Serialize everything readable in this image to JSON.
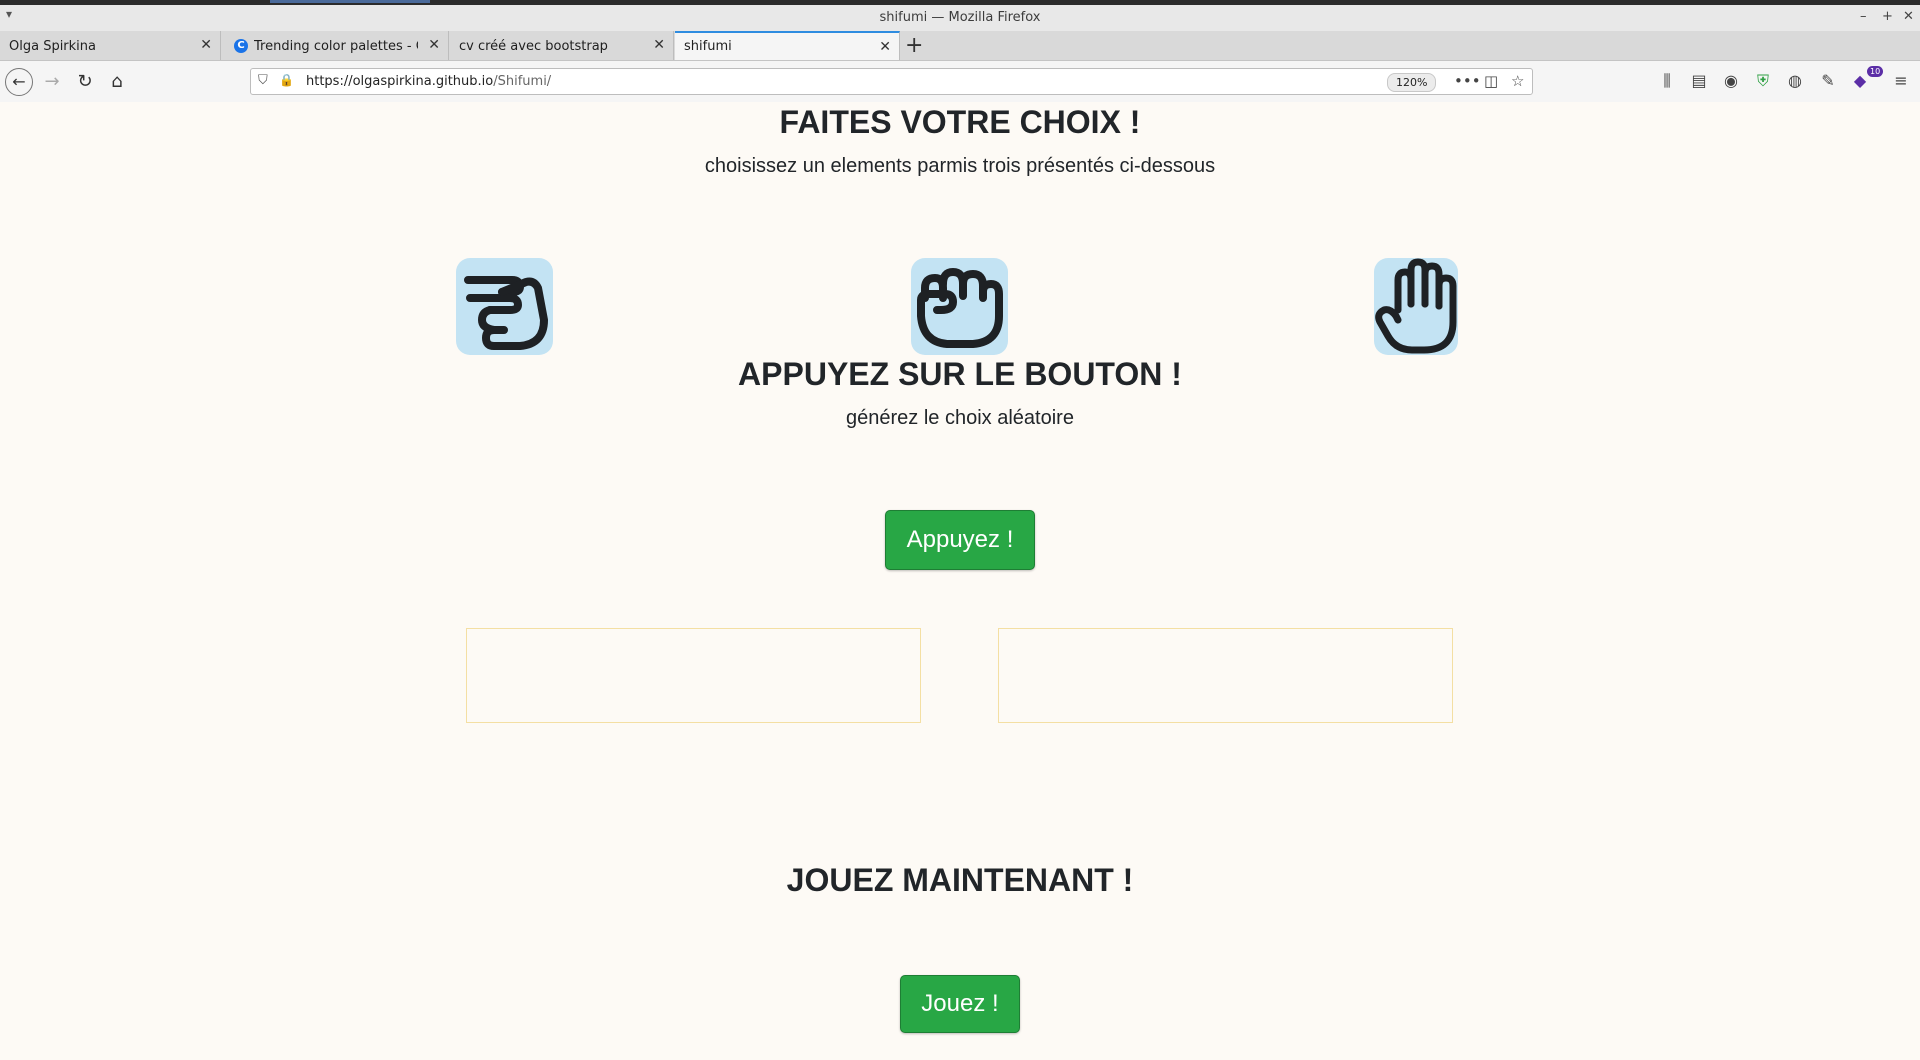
{
  "browser": {
    "window_title": "shifumi — Mozilla Firefox",
    "tabs": [
      {
        "label": "Olga Spirkina",
        "active": false
      },
      {
        "label": "Trending color palettes - Coolors",
        "active": false,
        "favicon": "C"
      },
      {
        "label": "cv créé avec bootstrap",
        "active": false
      },
      {
        "label": "shifumi",
        "active": true
      }
    ],
    "url_host": "https://olgaspirkina.github.io",
    "url_path": "/Shifumi/",
    "zoom": "120%",
    "extension_badge": "10"
  },
  "page": {
    "heading_choice": "FAITES VOTRE CHOIX !",
    "sub_choice": "choisissez un elements parmis trois présentés ci-dessous",
    "choices": [
      {
        "name": "scissors",
        "icon": "scissors-hand-icon"
      },
      {
        "name": "rock",
        "icon": "fist-icon"
      },
      {
        "name": "paper",
        "icon": "open-hand-icon"
      }
    ],
    "heading_button": "APPUYEZ SUR LE BOUTON !",
    "sub_button": "générez le choix aléatoire",
    "press_label": "Appuyez !",
    "result_left": "",
    "result_right": "",
    "heading_play": "JOUEZ MAINTENANT !",
    "play_label": "Jouez !"
  },
  "colors": {
    "background": "#fdfaf5",
    "button": "#28a745",
    "icon_bg": "#c3e3f3",
    "box_border": "#f4dfa3"
  }
}
